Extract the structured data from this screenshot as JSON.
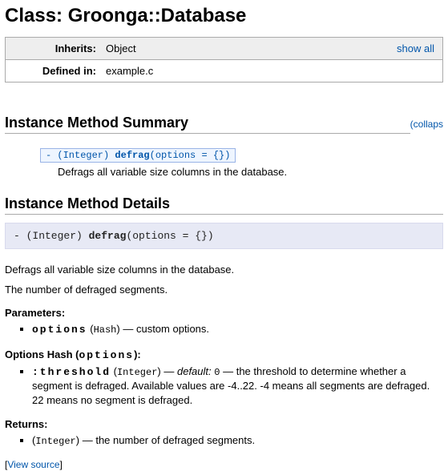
{
  "title": "Class: Groonga::Database",
  "box": {
    "inherits_label": "Inherits:",
    "inherits_value": "Object",
    "show_all": "show all",
    "defined_label": "Defined in:",
    "defined_value": "example.c"
  },
  "summary_heading": "Instance Method Summary",
  "collapse_label": "collaps",
  "summary": {
    "prefix": "- (Integer) ",
    "method": "defrag",
    "args": "(options = {})",
    "desc": "Defrags all variable size columns in the database."
  },
  "details_heading": "Instance Method Details",
  "method": {
    "prefix": "- (Integer) ",
    "name": "defrag",
    "args": "(options = {})"
  },
  "desc1": "Defrags all variable size columns in the database.",
  "desc2": "The number of defraged segments.",
  "params": {
    "title": "Parameters:",
    "name": "options",
    "type": "Hash",
    "desc": "custom options."
  },
  "opts": {
    "title_prefix": "Options Hash (",
    "title_mono": "options",
    "title_suffix": "):",
    "name": ":threshold",
    "type": "Integer",
    "default_label": "default:",
    "default_value": "0",
    "desc": "the threshold to determine whether a segment is defraged. Available values are -4..22. -4 means all segments are defraged. 22 means no segment is defraged."
  },
  "returns": {
    "title": "Returns:",
    "type": "Integer",
    "desc": "the number of defraged segments."
  },
  "source_link": "View source"
}
